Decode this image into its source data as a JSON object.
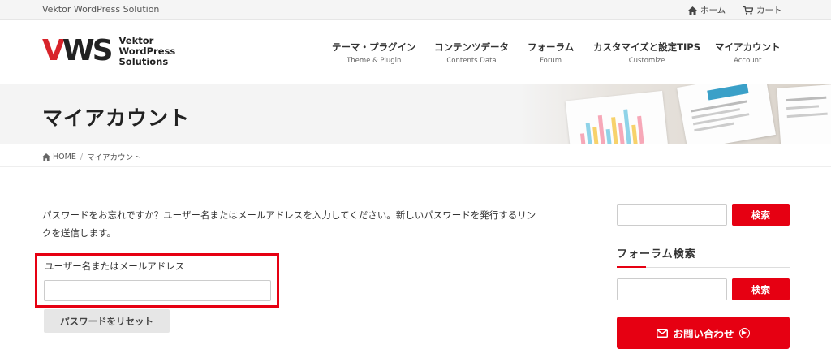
{
  "topbar": {
    "site_name": "Vektor WordPress Solution",
    "home_label": "ホーム",
    "cart_label": "カート"
  },
  "logo": {
    "mark_v": "V",
    "mark_ws": "WS",
    "line1": "Vektor",
    "line2": "WordPress",
    "line3": "Solutions"
  },
  "nav": [
    {
      "ja": "テーマ・プラグイン",
      "en": "Theme & Plugin"
    },
    {
      "ja": "コンテンツデータ",
      "en": "Contents Data"
    },
    {
      "ja": "フォーラム",
      "en": "Forum"
    },
    {
      "ja": "カスタマイズと設定TIPS",
      "en": "Customize"
    },
    {
      "ja": "マイアカウント",
      "en": "Account"
    }
  ],
  "page": {
    "title": "マイアカウント"
  },
  "breadcrumb": {
    "home": "HOME",
    "separator": "/",
    "current": "マイアカウント"
  },
  "form": {
    "description": "パスワードをお忘れですか？ユーザー名またはメールアドレスを入力してください。新しいパスワードを発行するリンクを送信します。",
    "field_label": "ユーザー名またはメールアドレス",
    "field_value": "",
    "reset_label": "パスワードをリセット"
  },
  "sidebar": {
    "search_button": "検索",
    "forum_heading": "フォーラム検索",
    "forum_search_button": "検索",
    "contact_label": "お問い合わせ"
  },
  "colors": {
    "accent": "#e60012",
    "highlight_box": "#e60012"
  }
}
